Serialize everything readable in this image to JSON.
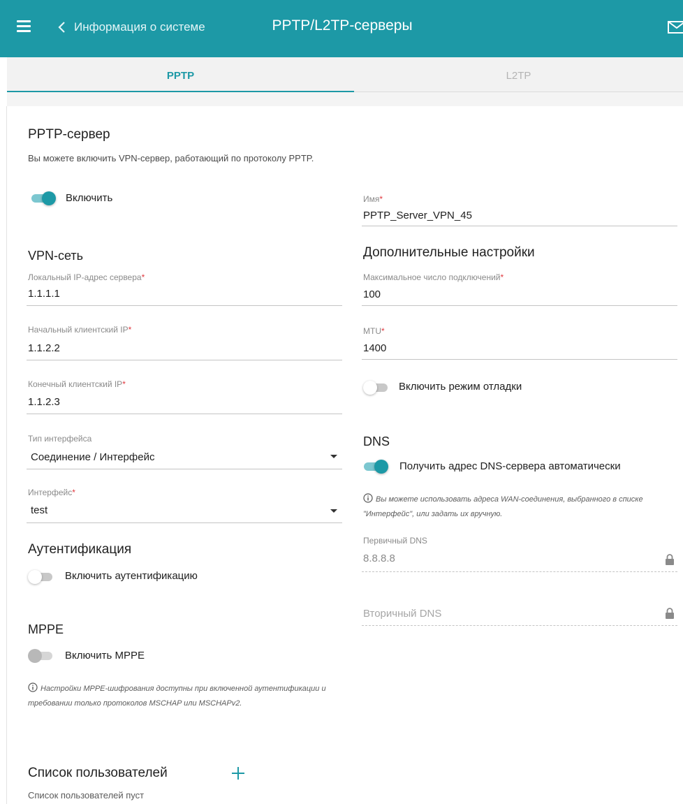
{
  "header": {
    "back_label": "Информация о системе",
    "title": "PPTP/L2TP-серверы"
  },
  "tabs": [
    {
      "label": "PPTP",
      "active": true
    },
    {
      "label": "L2TP",
      "active": false
    }
  ],
  "section": {
    "title": "PPTP-сервер",
    "description": "Вы можете включить VPN-сервер, работающий по протоколу PPTP."
  },
  "enable": {
    "label": "Включить",
    "on": true
  },
  "name_field": {
    "label": "Имя",
    "value": "PPTP_Server_VPN_45"
  },
  "vpn": {
    "title": "VPN-сеть",
    "local_ip": {
      "label": "Локальный IP-адрес сервера",
      "value": "1.1.1.1"
    },
    "start_ip": {
      "label": "Начальный клиентский IP",
      "value": "1.1.2.2"
    },
    "end_ip": {
      "label": "Конечный клиентский IP",
      "value": "1.1.2.3"
    },
    "iface_type": {
      "label": "Тип интерфейса",
      "value": "Соединение / Интерфейс"
    },
    "iface": {
      "label": "Интерфейс",
      "value": "test"
    }
  },
  "advanced": {
    "title": "Дополнительные настройки",
    "max_conn": {
      "label": "Максимальное число подключений",
      "value": "100"
    },
    "mtu": {
      "label": "MTU",
      "value": "1400"
    },
    "debug": {
      "label": "Включить режим отладки",
      "on": false
    }
  },
  "dns": {
    "title": "DNS",
    "auto": {
      "label": "Получить адрес DNS-сервера автоматически",
      "on": true
    },
    "note": "Вы можете использовать адреса WAN-соединения, выбранного в списке \"Интерфейс\", или задать их вручную.",
    "primary": {
      "label": "Первичный DNS",
      "value": "8.8.8.8"
    },
    "secondary": {
      "placeholder": "Вторичный DNS"
    }
  },
  "auth": {
    "title": "Аутентификация",
    "toggle": {
      "label": "Включить аутентификацию",
      "on": false
    }
  },
  "mppe": {
    "title": "MPPE",
    "toggle": {
      "label": "Включить MPPE",
      "on": false,
      "disabled": true
    },
    "note": "Настройки MPPE-шифрования доступны при включенной аутентификации и требовании только протоколов MSCHAP или MSCHAPv2."
  },
  "users": {
    "title": "Список пользователей",
    "empty_text": "Список пользователей пуст"
  },
  "colors": {
    "accent": "#1d99a6",
    "required": "#e0383e"
  },
  "icons": {
    "menu": "hamburger-menu-icon",
    "back": "chevron-left-icon",
    "mail": "envelope-icon",
    "info": "info-circle-icon",
    "lock": "lock-icon",
    "add": "plus-icon",
    "dropdown": "caret-down-icon"
  }
}
